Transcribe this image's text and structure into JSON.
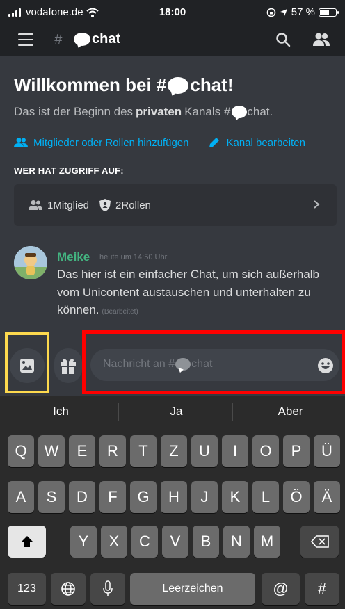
{
  "status_bar": {
    "carrier": "vodafone.de",
    "time": "18:00",
    "battery": "57 %"
  },
  "header": {
    "channel_name": "chat"
  },
  "welcome": {
    "title_prefix": "Willkommen bei #",
    "title_suffix": "chat!",
    "desc_start": "Das ist der Beginn des",
    "desc_bold": "privaten",
    "desc_end": "Kanals #",
    "desc_channel": "chat."
  },
  "actions": {
    "add_members": "Mitglieder oder Rollen hinzufügen",
    "edit_channel": "Kanal bearbeiten"
  },
  "access": {
    "title": "WER HAT ZUGRIFF AUF:",
    "members": "1Mitglied",
    "roles": "2Rollen"
  },
  "message": {
    "author": "Meike",
    "time": "heute um 14:50 Uhr",
    "lines": [
      "Das hier ist ein einfacher Chat, um sich außerhalb",
      "vom Unicontent austauschen und unterhalten zu",
      "können."
    ],
    "edited": "(Bearbeitet)"
  },
  "composer": {
    "placeholder_prefix": "Nachricht an #",
    "placeholder_suffix": "chat"
  },
  "keyboard": {
    "suggestions": [
      "Ich",
      "Ja",
      "Aber"
    ],
    "row1": [
      "Q",
      "W",
      "E",
      "R",
      "T",
      "Z",
      "U",
      "I",
      "O",
      "P",
      "Ü"
    ],
    "row2": [
      "A",
      "S",
      "D",
      "F",
      "G",
      "H",
      "J",
      "K",
      "L",
      "Ö",
      "Ä"
    ],
    "row3": [
      "Y",
      "X",
      "C",
      "V",
      "B",
      "N",
      "M"
    ],
    "numbers": "123",
    "space": "Leerzeichen",
    "at": "@",
    "hash": "#"
  },
  "colors": {
    "accent_link": "#00b0f4",
    "author": "#43b581",
    "highlight_yellow": "#fdd94e",
    "highlight_red": "#ff0000"
  }
}
